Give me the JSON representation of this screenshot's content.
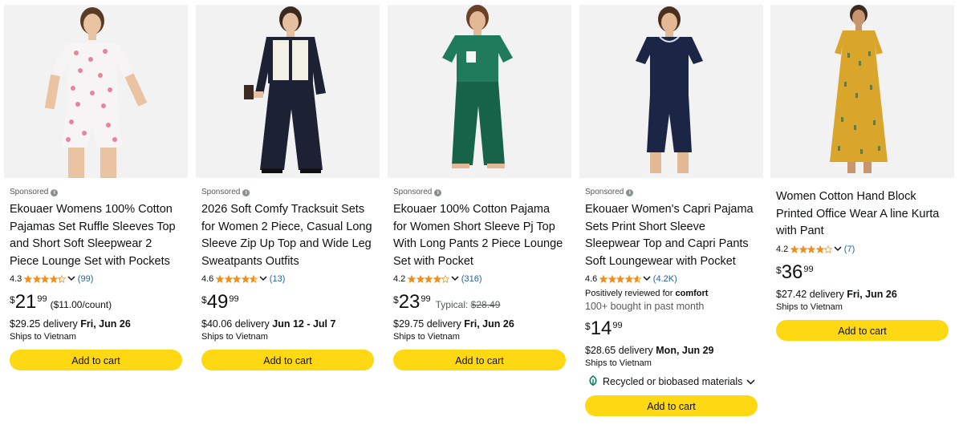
{
  "products": [
    {
      "sponsored_label": "Sponsored",
      "title": "Ekouaer Womens 100% Cotton Pajamas Set Ruffle Sleeves Top and Short Soft Sleepwear 2 Piece Lounge Set with Pockets",
      "rating": "4.3",
      "rating_value": 4.3,
      "reviews": "(99)",
      "price_symbol": "$",
      "price_whole": "21",
      "price_fraction": "99",
      "unit_price": "($11.00/count)",
      "delivery_price": "$29.25 delivery",
      "delivery_date": "Fri, Jun 26",
      "ships_to": "Ships to Vietnam",
      "add_to_cart": "Add to cart",
      "image_colors": [
        "#f5f5f5",
        "#e8849f"
      ]
    },
    {
      "sponsored_label": "Sponsored",
      "title": "2026 Soft Comfy Tracksuit Sets for Women 2 Piece, Casual Long Sleeve Zip Up Top and Wide Leg Sweatpants Outfits",
      "rating": "4.6",
      "rating_value": 4.6,
      "reviews": "(13)",
      "price_symbol": "$",
      "price_whole": "49",
      "price_fraction": "99",
      "delivery_price": "$40.06 delivery",
      "delivery_date": "Jun 12 - Jul 7",
      "ships_to": "Ships to Vietnam",
      "add_to_cart": "Add to cart",
      "image_colors": [
        "#1c2233",
        "#f3f0e6"
      ]
    },
    {
      "sponsored_label": "Sponsored",
      "title": "Ekouaer 100% Cotton Pajama for Women Short Sleeve Pj Top With Long Pants 2 Piece Lounge Set with Pocket",
      "rating": "4.2",
      "rating_value": 4.2,
      "reviews": "(316)",
      "price_symbol": "$",
      "price_whole": "23",
      "price_fraction": "99",
      "typical_label": "Typical:",
      "typical_price": "$28.49",
      "delivery_price": "$29.75 delivery",
      "delivery_date": "Fri, Jun 26",
      "ships_to": "Ships to Vietnam",
      "add_to_cart": "Add to cart",
      "image_colors": [
        "#1f7b5c",
        "#176349"
      ]
    },
    {
      "sponsored_label": "Sponsored",
      "title": "Ekouaer Women's Capri Pajama Sets Print Short Sleeve Sleepwear Top and Capri Pants Soft Loungewear with Pocket",
      "rating": "4.6",
      "rating_value": 4.6,
      "reviews": "(4.2K)",
      "review_note_prefix": "Positively reviewed for",
      "review_note_bold": "comfort",
      "bought_note": "100+ bought in past month",
      "price_symbol": "$",
      "price_whole": "14",
      "price_fraction": "99",
      "delivery_price": "$28.65 delivery",
      "delivery_date": "Mon, Jun 29",
      "ships_to": "Ships to Vietnam",
      "recycled_label": "Recycled or biobased materials",
      "add_to_cart": "Add to cart",
      "image_colors": [
        "#1b2546",
        "#d7dbe7"
      ]
    },
    {
      "title": "Women Cotton Hand Block Printed Office Wear A line Kurta with Pant",
      "rating": "4.2",
      "rating_value": 4.2,
      "reviews": "(7)",
      "price_symbol": "$",
      "price_whole": "36",
      "price_fraction": "99",
      "delivery_price": "$27.42 delivery",
      "delivery_date": "Fri, Jun 26",
      "ships_to": "Ships to Vietnam",
      "add_to_cart": "Add to cart",
      "image_colors": [
        "#d9a62b",
        "#6a7a3b"
      ]
    }
  ],
  "colors": {
    "star": "#f08f1d",
    "link": "#2162a1",
    "button": "#ffd814",
    "card_image_bg": "#f2f2f2",
    "leaf": "#067d62"
  },
  "icons": {
    "info": "info-circle-icon",
    "star": "star-icon",
    "chevron": "chevron-down-icon",
    "leaf": "leaf-icon"
  }
}
